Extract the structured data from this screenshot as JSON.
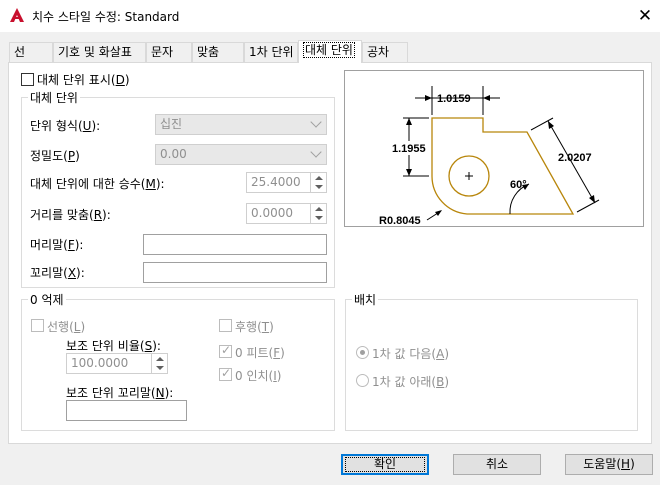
{
  "window": {
    "title": "치수 스타일 수정: Standard",
    "close_glyph": "✕"
  },
  "tabs": [
    {
      "label": "선"
    },
    {
      "label": "기호 및 화살표"
    },
    {
      "label": "문자"
    },
    {
      "label": "맞춤"
    },
    {
      "label": "1차 단위"
    },
    {
      "label": "대체 단위"
    },
    {
      "label": "공차"
    }
  ],
  "display_alt": {
    "pre": "대체 단위 표시(",
    "key": "D",
    "post": ")"
  },
  "alt_units": {
    "group_title": "대체 단위",
    "unit_format": {
      "pre": "단위 형식(",
      "key": "U",
      "post": "):",
      "value": "십진"
    },
    "precision": {
      "pre": "정밀도(",
      "key": "P",
      "post": ")",
      "value": "0.00"
    },
    "multiplier": {
      "pre": "대체 단위에 대한 승수(",
      "key": "M",
      "post": "):",
      "value": "25.4000"
    },
    "round": {
      "pre": "거리를 맞춤(",
      "key": "R",
      "post": "):",
      "value": "0.0000"
    },
    "prefix": {
      "pre": "머리말(",
      "key": "F",
      "post": "):"
    },
    "suffix": {
      "pre": "꼬리말(",
      "key": "X",
      "post": "):"
    }
  },
  "zero_suppression": {
    "group_title": "0 억제",
    "leading": {
      "pre": "선행(",
      "key": "L",
      "post": ")"
    },
    "sub_factor": {
      "pre": "보조 단위 비율(",
      "key": "S",
      "post": "):",
      "value": "100.0000"
    },
    "sub_suffix": {
      "pre": "보조 단위 꼬리말(",
      "key": "N",
      "post": "):"
    },
    "trailing": {
      "pre": "후행(",
      "key": "T",
      "post": ")"
    },
    "feet": {
      "pre": "0 피트(",
      "key": "F",
      "post": ")"
    },
    "inches": {
      "pre": "0 인치(",
      "key": "I",
      "post": ")"
    }
  },
  "placement": {
    "group_title": "배치",
    "after": {
      "pre": "1차 값 다음(",
      "key": "A",
      "post": ")"
    },
    "below": {
      "pre": "1차 값 아래(",
      "key": "B",
      "post": ")"
    }
  },
  "preview": {
    "dim_top": "1.0159",
    "dim_left": "1.1955",
    "dim_diag": "2.0207",
    "angle": "60°",
    "radius": "R0.8045"
  },
  "buttons": {
    "ok": "확인",
    "cancel": "취소",
    "help": {
      "pre": "도움말(",
      "key": "H",
      "post": ")"
    }
  },
  "colors": {
    "accent": "#0078d7",
    "preview_outline": "#b8860b",
    "app_icon": "#c8102e"
  }
}
